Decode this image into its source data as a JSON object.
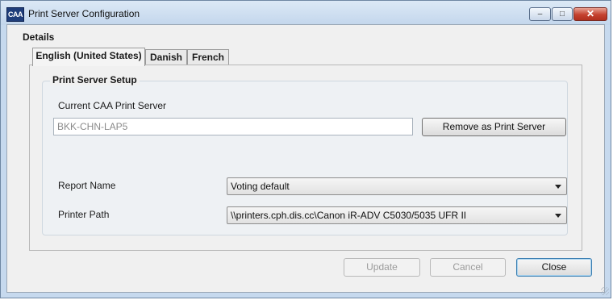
{
  "window": {
    "icon_text": "CAA",
    "title": "Print Server Configuration",
    "controls": {
      "minimize": "–",
      "maximize": "□",
      "close": "✕"
    }
  },
  "details": {
    "label": "Details",
    "tabs": [
      {
        "label": "English (United States)",
        "active": true
      },
      {
        "label": "Danish",
        "active": false
      },
      {
        "label": "French",
        "active": false
      }
    ]
  },
  "print_server_setup": {
    "title": "Print Server Setup",
    "current_server_label": "Current CAA Print Server",
    "current_server_value": "BKK-CHN-LAP5",
    "remove_button": "Remove as Print Server",
    "report_name_label": "Report Name",
    "report_name_value": "Voting default",
    "printer_path_label": "Printer Path",
    "printer_path_value": "\\\\printers.cph.dis.cc\\Canon iR-ADV C5030/5035 UFR II"
  },
  "footer": {
    "update": "Update",
    "cancel": "Cancel",
    "close": "Close"
  }
}
